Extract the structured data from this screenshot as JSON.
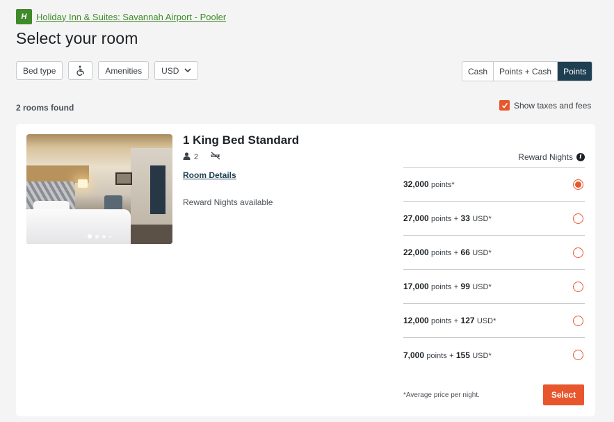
{
  "header": {
    "logo_glyph": "H",
    "hotel_name": "Holiday Inn & Suites: Savannah Airport - Pooler",
    "page_title": "Select your room"
  },
  "filters": {
    "bed_type": "Bed type",
    "accessibility_icon": "wheelchair-icon",
    "amenities": "Amenities",
    "currency": "USD"
  },
  "payment_toggle": {
    "options": [
      "Cash",
      "Points + Cash",
      "Points"
    ],
    "selected": "Points"
  },
  "results": {
    "count_label": "2 rooms found",
    "show_taxes_label": "Show taxes and fees",
    "show_taxes_checked": true
  },
  "room": {
    "name": "1 King Bed Standard",
    "guests": "2",
    "smoking_icon": "no-smoking-icon",
    "details_link": "Room Details",
    "availability": "Reward Nights available",
    "photo_count": 4,
    "photo_active_index": 0,
    "rates_header": "Reward Nights",
    "rates": [
      {
        "points": "32,000",
        "points_unit": "points*",
        "cash": "",
        "cash_unit": "",
        "selected": true
      },
      {
        "points": "27,000",
        "points_unit": "points",
        "cash": "33",
        "cash_unit": "USD*",
        "selected": false
      },
      {
        "points": "22,000",
        "points_unit": "points",
        "cash": "66",
        "cash_unit": "USD*",
        "selected": false
      },
      {
        "points": "17,000",
        "points_unit": "points",
        "cash": "99",
        "cash_unit": "USD*",
        "selected": false
      },
      {
        "points": "12,000",
        "points_unit": "points",
        "cash": "127",
        "cash_unit": "USD*",
        "selected": false
      },
      {
        "points": "7,000",
        "points_unit": "points",
        "cash": "155",
        "cash_unit": "USD*",
        "selected": false
      }
    ],
    "plus_sign": "+",
    "footnote": "*Average price per night.",
    "select_label": "Select"
  },
  "colors": {
    "brand_green": "#3f8a2a",
    "accent_orange": "#e8562d",
    "navy": "#1e3f52"
  }
}
